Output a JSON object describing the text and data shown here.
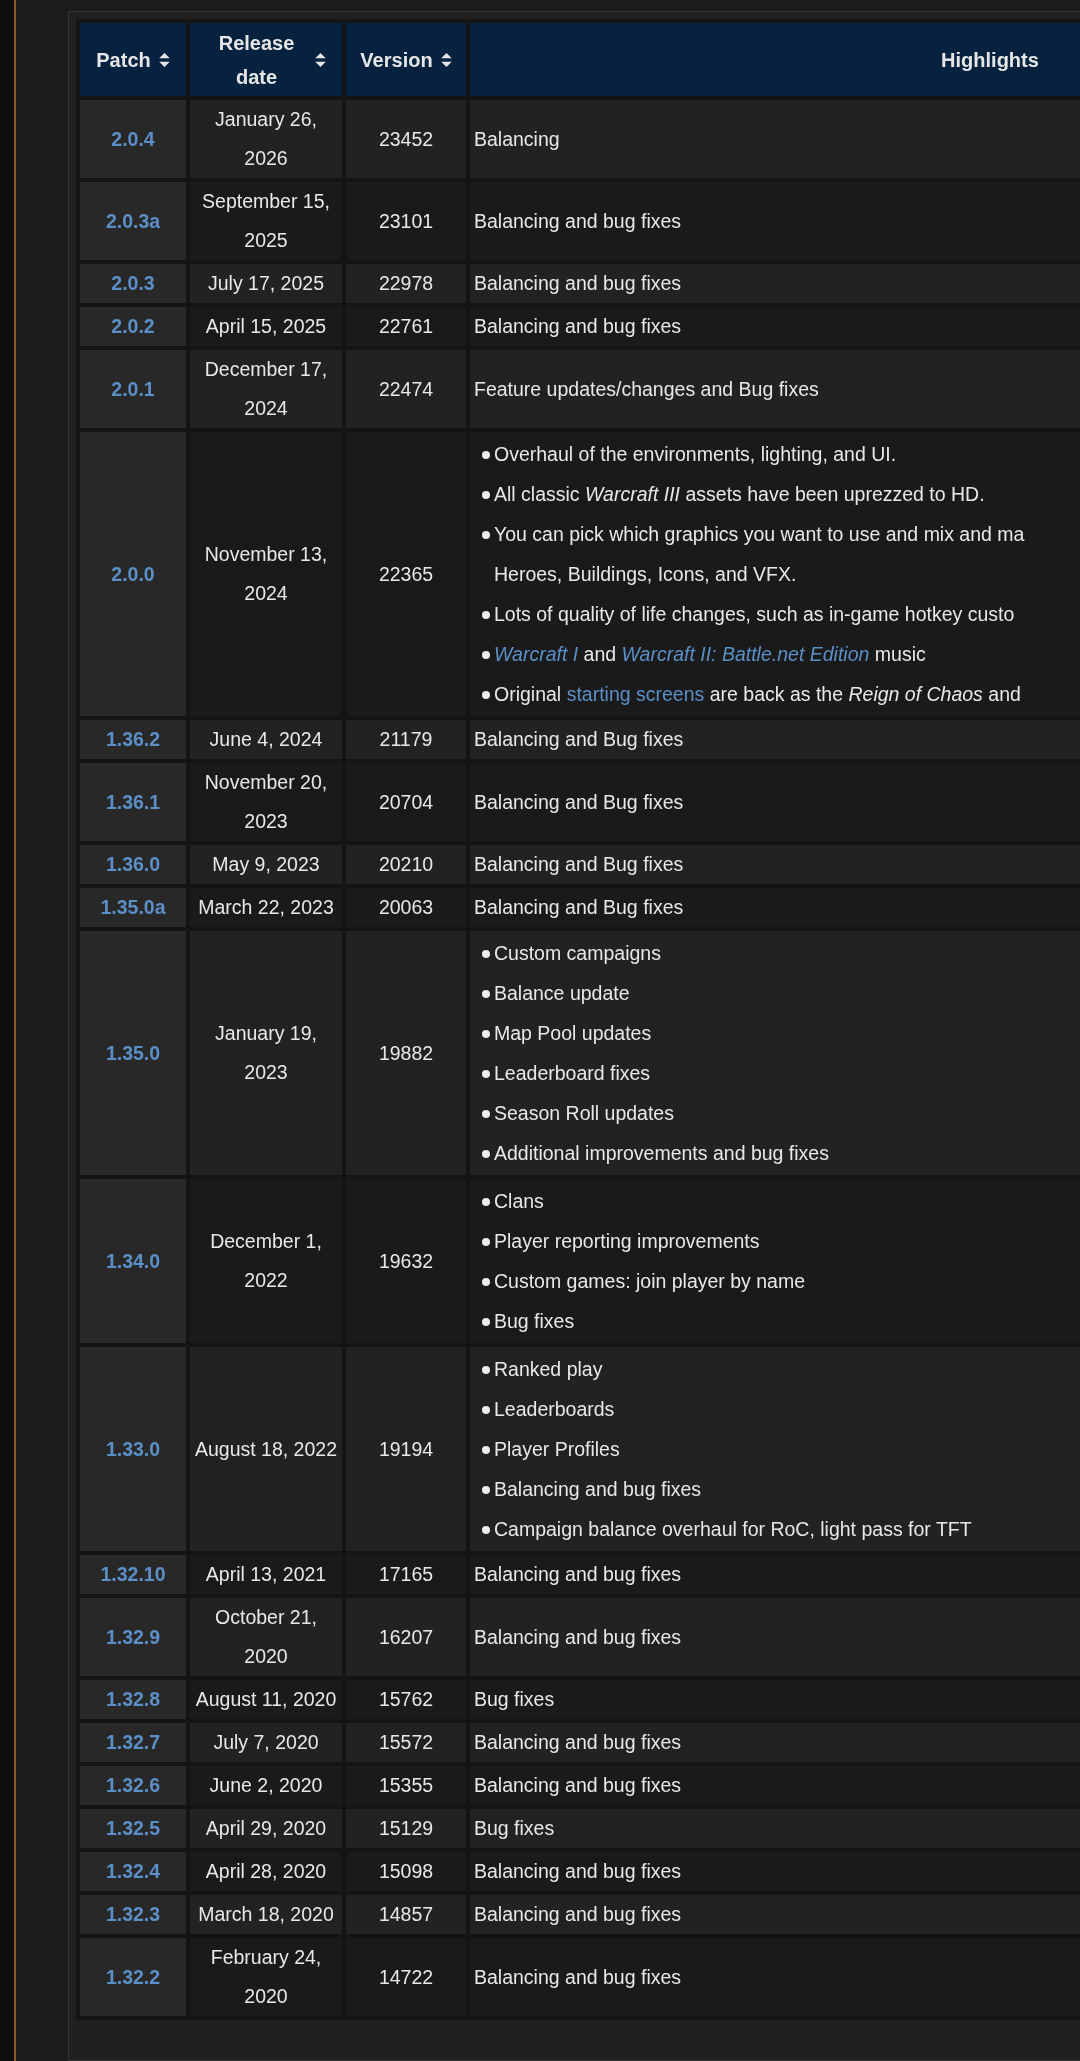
{
  "table": {
    "columns": [
      {
        "label": "Patch",
        "sortable": true
      },
      {
        "label": "Release date",
        "sortable": true
      },
      {
        "label": "Version",
        "sortable": true
      },
      {
        "label": "Highlights",
        "sortable": false
      }
    ],
    "rows": [
      {
        "patch": "2.0.4",
        "date": "January 26, 2026",
        "version": "23452",
        "kind": "text",
        "highlights": "Balancing"
      },
      {
        "patch": "2.0.3a",
        "date": "September 15, 2025",
        "version": "23101",
        "kind": "text",
        "highlights": "Balancing and bug fixes"
      },
      {
        "patch": "2.0.3",
        "date": "July 17, 2025",
        "version": "22978",
        "kind": "text",
        "highlights": "Balancing and bug fixes"
      },
      {
        "patch": "2.0.2",
        "date": "April 15, 2025",
        "version": "22761",
        "kind": "text",
        "highlights": "Balancing and bug fixes"
      },
      {
        "patch": "2.0.1",
        "date": "December 17, 2024",
        "version": "22474",
        "kind": "text",
        "highlights": "Feature updates/changes and Bug fixes"
      },
      {
        "patch": "2.0.0",
        "date": "November 13, 2024",
        "version": "22365",
        "kind": "list",
        "items": [
          [
            {
              "text": "Overhaul of the environments, lighting, and UI."
            }
          ],
          [
            {
              "text": "All classic "
            },
            {
              "text": "Warcraft III",
              "italic": true
            },
            {
              "text": " assets have been uprezzed to HD."
            }
          ],
          [
            {
              "text": "You can pick which graphics you want to use and mix and ma"
            },
            {
              "text": "Heroes, Buildings, Icons, and VFX.",
              "break": true
            }
          ],
          [
            {
              "text": "Lots of quality of life changes, such as in-game hotkey custo"
            }
          ],
          [
            {
              "text": "Warcraft I",
              "italic": true,
              "link": true
            },
            {
              "text": " and "
            },
            {
              "text": "Warcraft II: Battle.net Edition",
              "italic": true,
              "link": true
            },
            {
              "text": " music"
            }
          ],
          [
            {
              "text": "Original "
            },
            {
              "text": "starting screens",
              "link": true
            },
            {
              "text": " are back as the "
            },
            {
              "text": "Reign of Chaos",
              "italic": true
            },
            {
              "text": " and"
            }
          ]
        ]
      },
      {
        "patch": "1.36.2",
        "date": "June 4, 2024",
        "version": "21179",
        "kind": "text",
        "highlights": "Balancing and Bug fixes"
      },
      {
        "patch": "1.36.1",
        "date": "November 20, 2023",
        "version": "20704",
        "kind": "text",
        "highlights": "Balancing and Bug fixes"
      },
      {
        "patch": "1.36.0",
        "date": "May 9, 2023",
        "version": "20210",
        "kind": "text",
        "highlights": "Balancing and Bug fixes"
      },
      {
        "patch": "1.35.0a",
        "date": "March 22, 2023",
        "version": "20063",
        "kind": "text",
        "highlights": "Balancing and Bug fixes"
      },
      {
        "patch": "1.35.0",
        "date": "January 19, 2023",
        "version": "19882",
        "kind": "list",
        "items": [
          [
            {
              "text": "Custom campaigns"
            }
          ],
          [
            {
              "text": "Balance update"
            }
          ],
          [
            {
              "text": "Map Pool updates"
            }
          ],
          [
            {
              "text": "Leaderboard fixes"
            }
          ],
          [
            {
              "text": "Season Roll updates"
            }
          ],
          [
            {
              "text": "Additional improvements and bug fixes"
            }
          ]
        ]
      },
      {
        "patch": "1.34.0",
        "date": "December 1, 2022",
        "version": "19632",
        "kind": "list",
        "items": [
          [
            {
              "text": "Clans"
            }
          ],
          [
            {
              "text": "Player reporting improvements"
            }
          ],
          [
            {
              "text": "Custom games: join player by name"
            }
          ],
          [
            {
              "text": "Bug fixes"
            }
          ]
        ]
      },
      {
        "patch": "1.33.0",
        "date": "August 18, 2022",
        "version": "19194",
        "kind": "list",
        "items": [
          [
            {
              "text": "Ranked play"
            }
          ],
          [
            {
              "text": "Leaderboards"
            }
          ],
          [
            {
              "text": "Player Profiles"
            }
          ],
          [
            {
              "text": "Balancing and bug fixes"
            }
          ],
          [
            {
              "text": "Campaign balance overhaul for RoC, light pass for TFT"
            }
          ]
        ]
      },
      {
        "patch": "1.32.10",
        "date": "April 13, 2021",
        "version": "17165",
        "kind": "text",
        "highlights": "Balancing and bug fixes"
      },
      {
        "patch": "1.32.9",
        "date": "October 21, 2020",
        "version": "16207",
        "kind": "text",
        "highlights": "Balancing and bug fixes"
      },
      {
        "patch": "1.32.8",
        "date": "August 11, 2020",
        "version": "15762",
        "kind": "text",
        "highlights": "Bug fixes"
      },
      {
        "patch": "1.32.7",
        "date": "July 7, 2020",
        "version": "15572",
        "kind": "text",
        "highlights": "Balancing and bug fixes"
      },
      {
        "patch": "1.32.6",
        "date": "June 2, 2020",
        "version": "15355",
        "kind": "text",
        "highlights": "Balancing and bug fixes"
      },
      {
        "patch": "1.32.5",
        "date": "April 29, 2020",
        "version": "15129",
        "kind": "text",
        "highlights": "Bug fixes"
      },
      {
        "patch": "1.32.4",
        "date": "April 28, 2020",
        "version": "15098",
        "kind": "text",
        "highlights": "Balancing and bug fixes"
      },
      {
        "patch": "1.32.3",
        "date": "March 18, 2020",
        "version": "14857",
        "kind": "text",
        "highlights": "Balancing and bug fixes"
      },
      {
        "patch": "1.32.2",
        "date": "February 24, 2020",
        "version": "14722",
        "kind": "text",
        "highlights": "Balancing and bug fixes"
      }
    ]
  }
}
